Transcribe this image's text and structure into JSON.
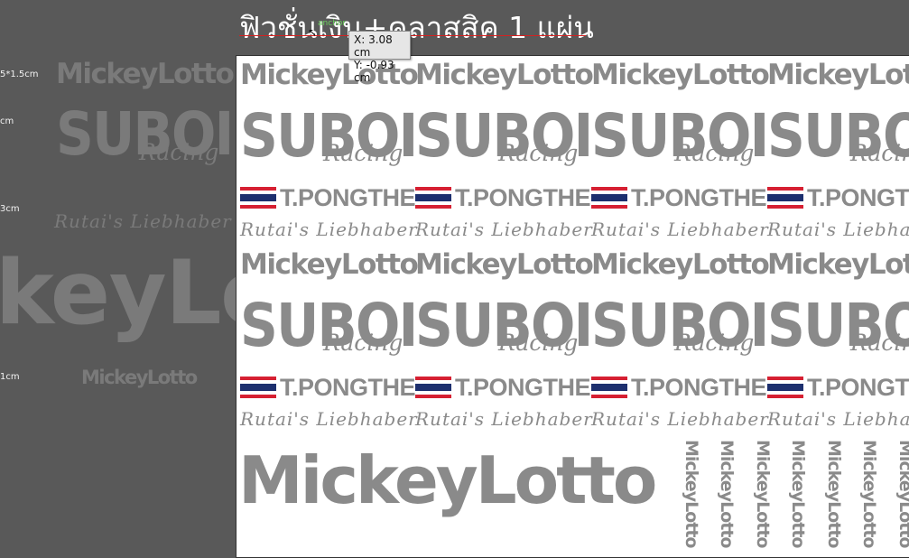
{
  "heading": "ฟิวชั่นเงิน+คลาสสิค 1 แผ่น",
  "anchor_label": "anchor",
  "tooltip": {
    "x": "X: 3.08 cm",
    "y": "Y: -0.93 cm"
  },
  "dimensions": [
    "5*1.5cm",
    "cm",
    "3cm",
    "1cm"
  ],
  "brand": {
    "mickey": "MickeyLotto",
    "suboi": "SUBOI",
    "racing": "Racing",
    "tpongthep": "T.PONGTHEP",
    "rutai": "Rutai's Liebhaber"
  },
  "colors": {
    "pasteboard": "#595959",
    "sticker_gray": "#8a8a8a",
    "flag_red": "#d62032",
    "flag_white": "#ffffff",
    "flag_blue": "#1d2f6e",
    "guide_red": "#d62020"
  }
}
